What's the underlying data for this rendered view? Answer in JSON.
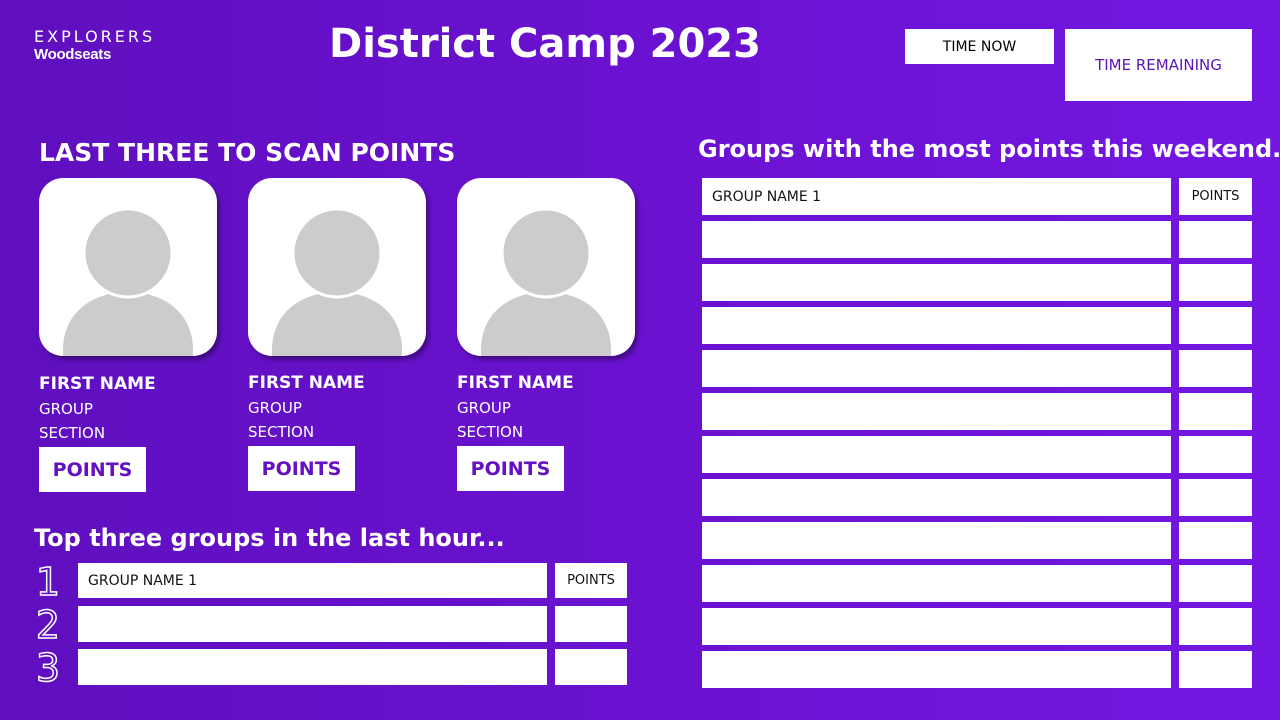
{
  "header": {
    "logo_top": "EXPLORERS",
    "logo_sub": "Woodseats",
    "title": "District Camp 2023",
    "time_now_label": "TIME NOW",
    "time_remaining_label": "TIME REMAINING"
  },
  "last_three": {
    "heading": "LAST THREE TO SCAN POINTS",
    "cards": [
      {
        "first_name": "FIRST NAME",
        "group": "GROUP",
        "section": "SECTION",
        "points_label": "POINTS"
      },
      {
        "first_name": "FIRST NAME",
        "group": "GROUP",
        "section": "SECTION",
        "points_label": "POINTS"
      },
      {
        "first_name": "FIRST NAME",
        "group": "GROUP",
        "section": "SECTION",
        "points_label": "POINTS"
      }
    ]
  },
  "top_hour": {
    "heading": "Top three groups in the last hour...",
    "rows": [
      {
        "rank": "1",
        "name": "GROUP NAME 1",
        "points": "POINTS"
      },
      {
        "rank": "2",
        "name": "",
        "points": ""
      },
      {
        "rank": "3",
        "name": "",
        "points": ""
      }
    ]
  },
  "weekend": {
    "heading": "Groups with the most points this weekend...",
    "rows": [
      {
        "name": "GROUP NAME 1",
        "points": "POINTS"
      },
      {
        "name": "",
        "points": ""
      },
      {
        "name": "",
        "points": ""
      },
      {
        "name": "",
        "points": ""
      },
      {
        "name": "",
        "points": ""
      },
      {
        "name": "",
        "points": ""
      },
      {
        "name": "",
        "points": ""
      },
      {
        "name": "",
        "points": ""
      },
      {
        "name": "",
        "points": ""
      },
      {
        "name": "",
        "points": ""
      },
      {
        "name": "",
        "points": ""
      },
      {
        "name": "",
        "points": ""
      }
    ]
  },
  "colors": {
    "background": "#6a12d0",
    "accent_text": "#6311c2",
    "avatar_placeholder": "#cccccc"
  },
  "icons": {
    "avatar": "user-silhouette-icon"
  }
}
